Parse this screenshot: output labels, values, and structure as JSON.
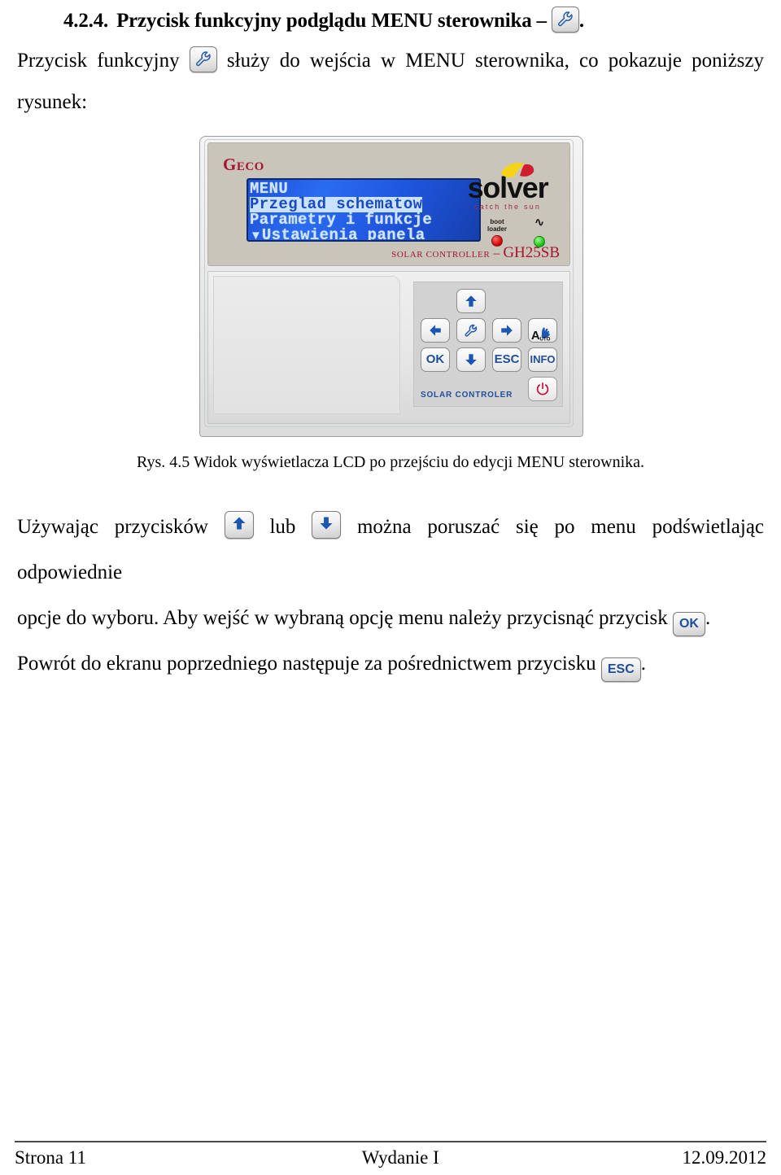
{
  "document": {
    "heading": {
      "number": "4.2.4.",
      "text": "Przycisk funkcyjny podglądu MENU sterownika –",
      "trailing": "."
    },
    "paragraphs": {
      "intro_before_icon": "Przycisk funkcyjny",
      "intro_after_icon": "służy do wejścia w MENU sterownika, co pokazuje poniższy",
      "intro_line2": "rysunek:",
      "nav_before_up": "Używając przycisków",
      "nav_between": "lub",
      "nav_after_down": "można poruszać się po menu podświetlając odpowiednie",
      "nav_line2_before_ok": "opcje do wyboru. Aby wejść w wybraną opcję menu należy przycisnąć przycisk",
      "nav_line2_after_ok": ".",
      "esc_line_before": "Powrót do ekranu poprzedniego następuje za pośrednictwem przycisku",
      "esc_line_after": "."
    },
    "figure": {
      "caption": "Rys. 4.5 Widok wyświetlacza LCD po przejściu do edycji MENU sterownika."
    },
    "footer": {
      "page": "Strona 11",
      "edition": "Wydanie I",
      "date": "12.09.2012"
    }
  },
  "device": {
    "brand": {
      "geco_first": "G",
      "geco_rest": "ECO"
    },
    "logo": {
      "word": "solver",
      "tagline": "catch the sun"
    },
    "lcd": {
      "line1": "MENU",
      "line2": "Przeglad schematow",
      "line3": "Parametry i funkcje",
      "line4": "Ustawienia panela",
      "scroll_arrow": "▼"
    },
    "leds": {
      "boot_label_line1": "boot",
      "boot_label_line2": "loader",
      "boot_color": "#cc0000",
      "power_symbol": "∿",
      "power_color": "#14bc17"
    },
    "model": {
      "prefix": "SOLAR CONTROLLER",
      "dash": "–",
      "name": "GH25SB"
    },
    "keypad": {
      "up": "up-arrow",
      "left": "left-arrow",
      "wrench": "wrench",
      "right": "right-arrow",
      "auto_letter": "A",
      "auto_sub": "UTO",
      "ok": "OK",
      "down": "down-arrow",
      "esc": "ESC",
      "info": "INFO",
      "power": "power",
      "label": "SOLAR  CONTROLER"
    }
  },
  "inline_keys": {
    "wrench": "wrench-icon",
    "up": "up-arrow-icon",
    "down": "down-arrow-icon",
    "ok": "OK",
    "esc": "ESC"
  },
  "colors": {
    "accent_blue": "#1f4e9c",
    "brand_red": "#a61430",
    "lcd_blue": "#2a6cf0",
    "lcd_text": "#cfe4ff",
    "power_red": "#c8103c"
  }
}
